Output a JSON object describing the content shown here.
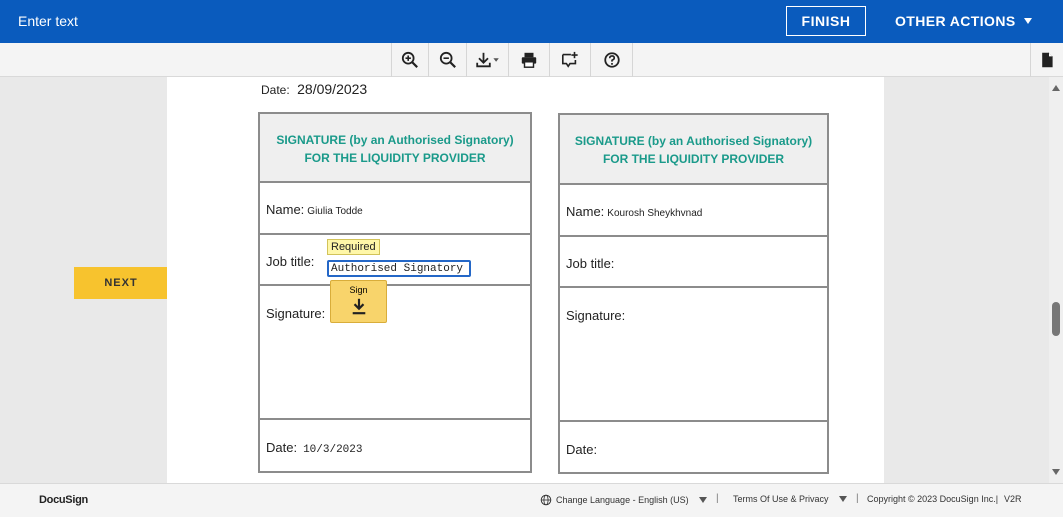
{
  "header": {
    "instruction": "Enter text",
    "finish_label": "FINISH",
    "other_actions_label": "OTHER ACTIONS",
    "background_color": "#0a5bbd"
  },
  "toolbar": {
    "tools": [
      "zoom-in-icon",
      "zoom-out-icon",
      "download-icon",
      "print-icon",
      "add-comment-icon",
      "help-icon"
    ],
    "pages_icon": "document-icon"
  },
  "navigation": {
    "next_label": "NEXT",
    "next_color": "#f7c32e"
  },
  "document": {
    "top_date_label": "Date:",
    "top_date_value": "28/09/2023",
    "left_box": {
      "heading_line1": "SIGNATURE (by an Authorised Signatory)",
      "heading_line2": "FOR THE LIQUIDITY PROVIDER",
      "name_label": "Name:",
      "name_value": "Giulia Todde",
      "job_label": "Job title:",
      "required_tag": "Required",
      "job_value": "Authorised Signatory",
      "signature_label": "Signature:",
      "sign_tag_label": "Sign",
      "date_label": "Date:",
      "date_value": "10/3/2023"
    },
    "right_box": {
      "heading_line1": "SIGNATURE (by an Authorised Signatory)",
      "heading_line2": "FOR THE LIQUIDITY PROVIDER",
      "name_label": "Name:",
      "name_value": "Kourosh Sheykhvnad",
      "job_label": "Job title:",
      "signature_label": "Signature:",
      "date_label": "Date:"
    },
    "heading_color": "#1a9a8a"
  },
  "footer": {
    "brand": "DocuSign",
    "change_language": "Change Language - English (US)",
    "separator": "|",
    "terms": "Terms Of Use & Privacy",
    "copyright": "Copyright © 2023 DocuSign Inc.|",
    "version": "V2R"
  }
}
